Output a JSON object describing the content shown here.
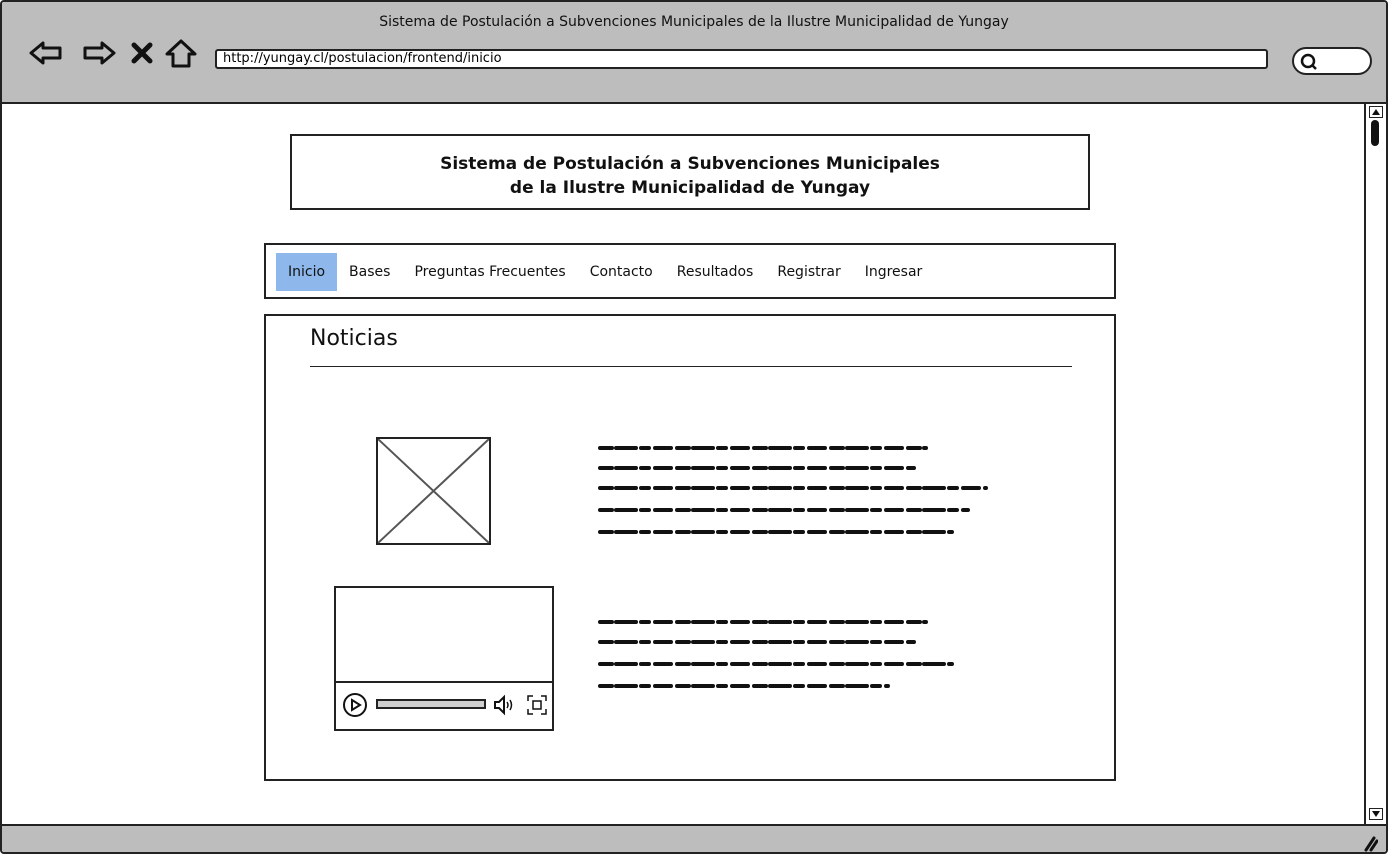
{
  "window": {
    "title": "Sistema de Postulación a Subvenciones Municipales de la Ilustre Municipalidad de Yungay",
    "url": "http://yungay.cl/postulacion/frontend/inicio",
    "toolbar": {
      "back_icon": "back-arrow-icon",
      "forward_icon": "forward-arrow-icon",
      "stop_icon": "close-icon",
      "home_icon": "home-icon"
    }
  },
  "header": {
    "line1": "Sistema de Postulación a Subvenciones Municipales",
    "line2": "de la Ilustre Municipalidad de Yungay"
  },
  "nav": {
    "items": [
      {
        "label": "Inicio",
        "active": true
      },
      {
        "label": "Bases",
        "active": false
      },
      {
        "label": "Preguntas Frecuentes",
        "active": false
      },
      {
        "label": "Contacto",
        "active": false
      },
      {
        "label": "Resultados",
        "active": false
      },
      {
        "label": "Registrar",
        "active": false
      },
      {
        "label": "Ingresar",
        "active": false
      }
    ]
  },
  "news": {
    "title": "Noticias"
  },
  "colors": {
    "chrome": "#bdbdbd",
    "active_tab": "#8eb8ec",
    "border": "#222222"
  }
}
